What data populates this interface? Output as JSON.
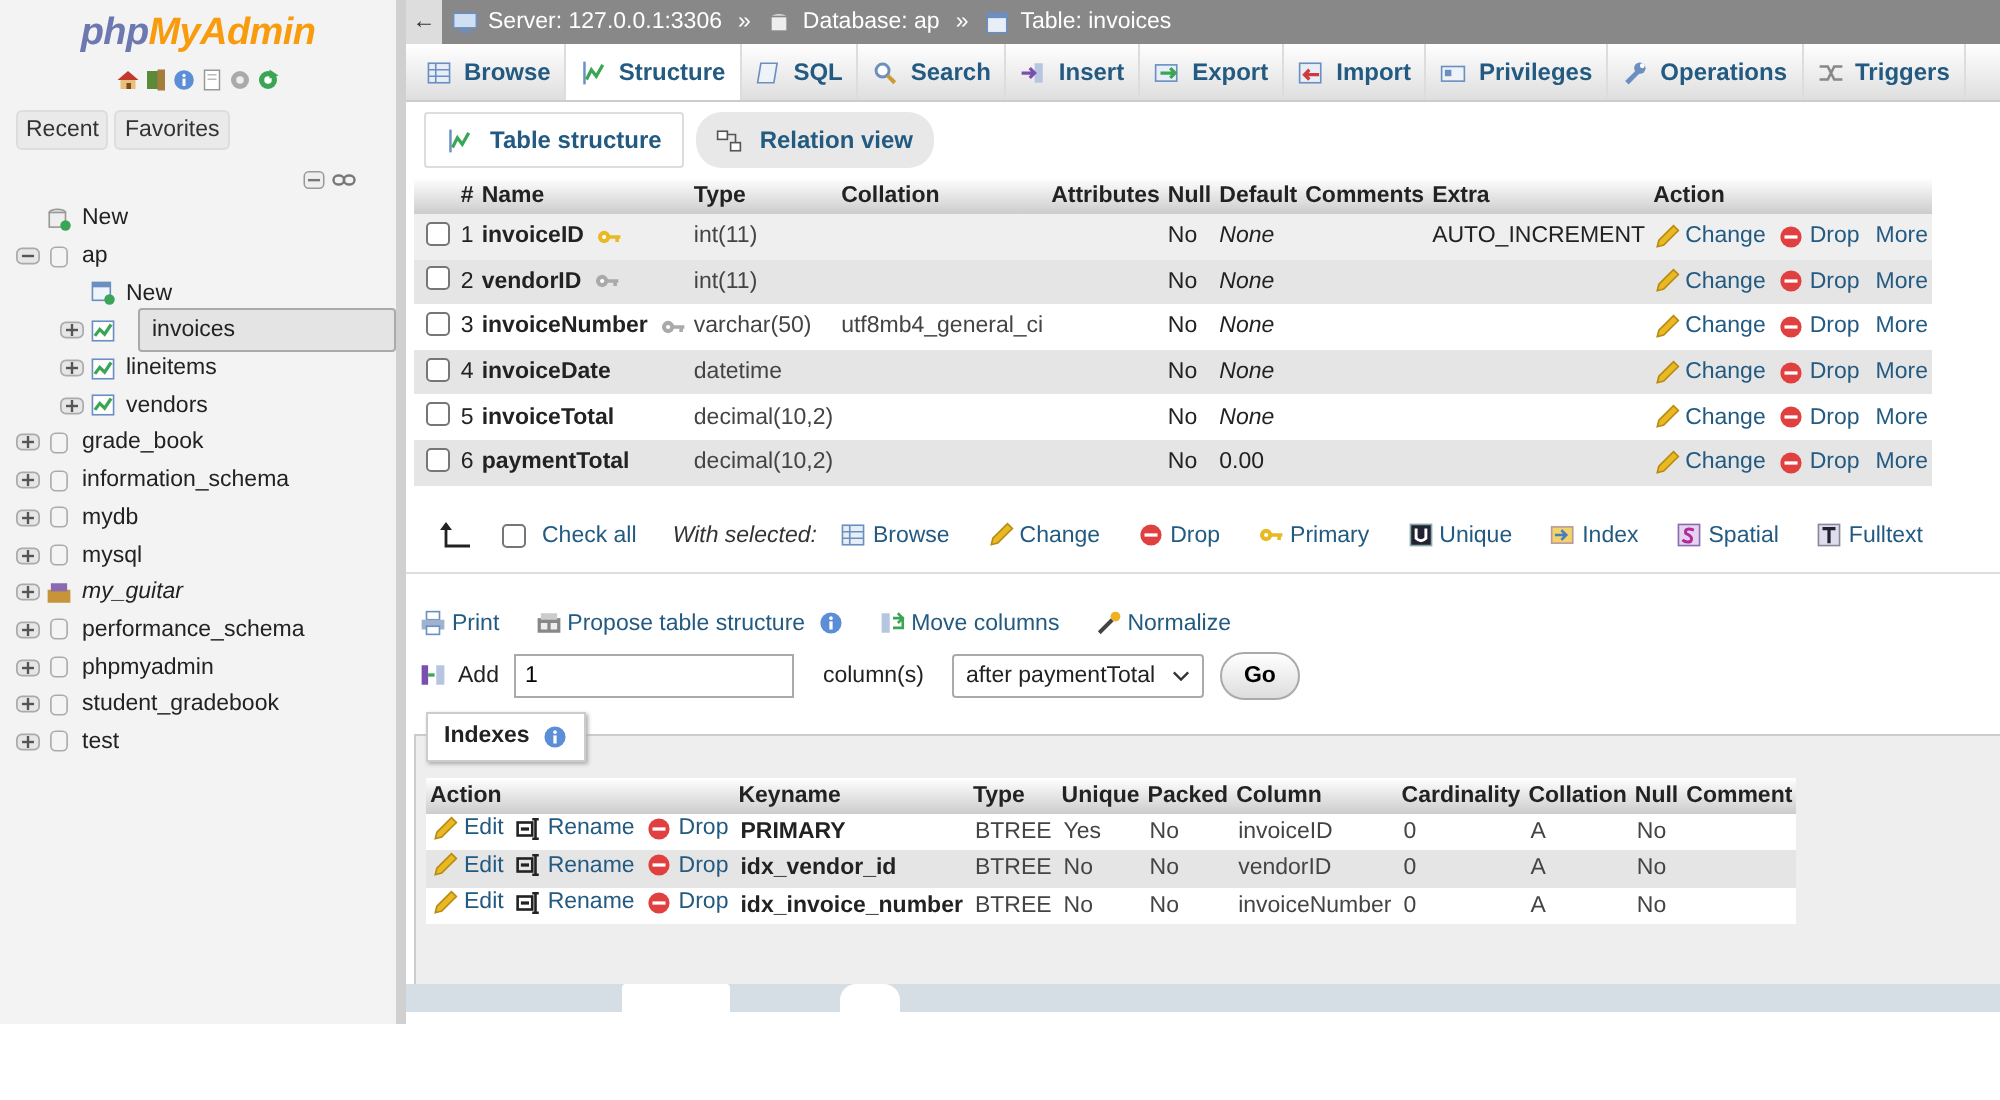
{
  "sidebar": {
    "logo": {
      "prefix": "php",
      "name": "MyAdmin"
    },
    "tabs": [
      {
        "label": "Recent"
      },
      {
        "label": "Favorites"
      }
    ],
    "tree": [
      {
        "kind": "new",
        "label": "New",
        "selected": false
      },
      {
        "kind": "db",
        "label": "ap",
        "expanded": true,
        "selected": false,
        "children": [
          {
            "kind": "new_table",
            "label": "New",
            "selected": false
          },
          {
            "kind": "table",
            "label": "invoices",
            "expanded": false,
            "selected": true
          },
          {
            "kind": "table",
            "label": "lineitems",
            "expanded": false,
            "selected": false
          },
          {
            "kind": "table",
            "label": "vendors",
            "expanded": false,
            "selected": false
          }
        ]
      },
      {
        "kind": "db",
        "label": "grade_book",
        "expanded": false,
        "selected": false
      },
      {
        "kind": "db",
        "label": "information_schema",
        "expanded": false,
        "selected": false
      },
      {
        "kind": "db",
        "label": "mydb",
        "expanded": false,
        "selected": false
      },
      {
        "kind": "db",
        "label": "mysql",
        "expanded": false,
        "selected": false
      },
      {
        "kind": "db_custom",
        "label": "my_guitar",
        "expanded": false,
        "selected": false
      },
      {
        "kind": "db",
        "label": "performance_schema",
        "expanded": false,
        "selected": false
      },
      {
        "kind": "db",
        "label": "phpmyadmin",
        "expanded": false,
        "selected": false
      },
      {
        "kind": "db",
        "label": "student_gradebook",
        "expanded": false,
        "selected": false
      },
      {
        "kind": "db",
        "label": "test",
        "expanded": false,
        "selected": false
      }
    ]
  },
  "breadcrumb": {
    "back": "←",
    "items": [
      {
        "kind": "server",
        "label": "Server: 127.0.0.1:3306"
      },
      {
        "kind": "sep",
        "label": "»"
      },
      {
        "kind": "database",
        "label": "Database: ap"
      },
      {
        "kind": "sep",
        "label": "»"
      },
      {
        "kind": "table",
        "label": "Table: invoices"
      }
    ]
  },
  "tabs": [
    {
      "kind": "browse",
      "label": "Browse",
      "selected": false
    },
    {
      "kind": "structure",
      "label": "Structure",
      "selected": true
    },
    {
      "kind": "sql",
      "label": "SQL",
      "selected": false
    },
    {
      "kind": "search",
      "label": "Search",
      "selected": false
    },
    {
      "kind": "insert",
      "label": "Insert",
      "selected": false
    },
    {
      "kind": "export",
      "label": "Export",
      "selected": false
    },
    {
      "kind": "import",
      "label": "Import",
      "selected": false
    },
    {
      "kind": "privileges",
      "label": "Privileges",
      "selected": false
    },
    {
      "kind": "operations",
      "label": "Operations",
      "selected": false
    },
    {
      "kind": "triggers",
      "label": "Triggers",
      "selected": false
    }
  ],
  "subtabs": [
    {
      "kind": "structure",
      "label": "Table structure",
      "selected": true
    },
    {
      "kind": "relation",
      "label": "Relation view",
      "selected": false
    }
  ],
  "structure": {
    "headers": [
      "#",
      "Name",
      "Type",
      "Collation",
      "Attributes",
      "Null",
      "Default",
      "Comments",
      "Extra",
      "Action"
    ],
    "rows": [
      {
        "num": "1",
        "name": "invoiceID",
        "kind": "primary",
        "type": "int(11)",
        "null": "No",
        "default": "None",
        "default_is_null": true,
        "extra": "AUTO_INCREMENT",
        "checked": false,
        "actions": [
          {
            "kind": "change",
            "label": "Change"
          },
          {
            "kind": "drop",
            "label": "Drop"
          },
          {
            "kind": "more",
            "label": "More"
          }
        ]
      },
      {
        "num": "2",
        "name": "vendorID",
        "kind": "index",
        "type": "int(11)",
        "null": "No",
        "default": "None",
        "default_is_null": true,
        "checked": false,
        "actions": [
          {
            "kind": "change",
            "label": "Change"
          },
          {
            "kind": "drop",
            "label": "Drop"
          },
          {
            "kind": "more",
            "label": "More"
          }
        ]
      },
      {
        "num": "3",
        "name": "invoiceNumber",
        "kind": "index",
        "type": "varchar(50)",
        "collation": "utf8mb4_general_ci",
        "null": "No",
        "default": "None",
        "default_is_null": true,
        "checked": false,
        "actions": [
          {
            "kind": "change",
            "label": "Change"
          },
          {
            "kind": "drop",
            "label": "Drop"
          },
          {
            "kind": "more",
            "label": "More"
          }
        ]
      },
      {
        "num": "4",
        "name": "invoiceDate",
        "kind": "plain",
        "type": "datetime",
        "null": "No",
        "default": "None",
        "default_is_null": true,
        "checked": false,
        "actions": [
          {
            "kind": "change",
            "label": "Change"
          },
          {
            "kind": "drop",
            "label": "Drop"
          },
          {
            "kind": "more",
            "label": "More"
          }
        ]
      },
      {
        "num": "5",
        "name": "invoiceTotal",
        "kind": "plain",
        "type": "decimal(10,2)",
        "null": "No",
        "default": "None",
        "default_is_null": true,
        "checked": false,
        "actions": [
          {
            "kind": "change",
            "label": "Change"
          },
          {
            "kind": "drop",
            "label": "Drop"
          },
          {
            "kind": "more",
            "label": "More"
          }
        ]
      },
      {
        "num": "6",
        "name": "paymentTotal",
        "kind": "plain",
        "type": "decimal(10,2)",
        "null": "No",
        "default": "0.00",
        "default_is_null": false,
        "checked": false,
        "actions": [
          {
            "kind": "change",
            "label": "Change"
          },
          {
            "kind": "drop",
            "label": "Drop"
          },
          {
            "kind": "more",
            "label": "More"
          }
        ]
      }
    ]
  },
  "bulk": {
    "check_all": "Check all",
    "checked": false,
    "with_selected": "With selected:",
    "actions": [
      {
        "kind": "browse",
        "label": "Browse"
      },
      {
        "kind": "change",
        "label": "Change"
      },
      {
        "kind": "drop",
        "label": "Drop"
      },
      {
        "kind": "primary",
        "label": "Primary"
      },
      {
        "kind": "unique",
        "label": "Unique"
      },
      {
        "kind": "index",
        "label": "Index"
      },
      {
        "kind": "spatial",
        "label": "Spatial"
      },
      {
        "kind": "fulltext",
        "label": "Fulltext"
      }
    ]
  },
  "tools": [
    {
      "kind": "print",
      "label": "Print"
    },
    {
      "kind": "propose",
      "label": "Propose table structure"
    },
    {
      "kind": "help"
    },
    {
      "kind": "move",
      "label": "Move columns"
    },
    {
      "kind": "normalize",
      "label": "Normalize"
    }
  ],
  "add_columns": {
    "label": "Add",
    "value": "1",
    "unit": "column(s)",
    "position": "after paymentTotal",
    "button": "Go"
  },
  "indexes": {
    "legend": "Indexes",
    "headers": [
      "Action",
      "Keyname",
      "Type",
      "Unique",
      "Packed",
      "Column",
      "Cardinality",
      "Collation",
      "Null",
      "Comment"
    ],
    "rows": [
      {
        "actions": [
          {
            "kind": "edit",
            "label": "Edit"
          },
          {
            "kind": "rename",
            "label": "Rename"
          },
          {
            "kind": "drop",
            "label": "Drop"
          }
        ],
        "keyname": "PRIMARY",
        "type": "BTREE",
        "unique": "Yes",
        "packed": "No",
        "column": "invoiceID",
        "cardinality": "0",
        "collation": "A",
        "null": "No"
      },
      {
        "actions": [
          {
            "kind": "edit",
            "label": "Edit"
          },
          {
            "kind": "rename",
            "label": "Rename"
          },
          {
            "kind": "drop",
            "label": "Drop"
          }
        ],
        "keyname": "idx_vendor_id",
        "type": "BTREE",
        "unique": "No",
        "packed": "No",
        "column": "vendorID",
        "cardinality": "0",
        "collation": "A",
        "null": "No"
      },
      {
        "actions": [
          {
            "kind": "edit",
            "label": "Edit"
          },
          {
            "kind": "rename",
            "label": "Rename"
          },
          {
            "kind": "drop",
            "label": "Drop"
          }
        ],
        "keyname": "idx_invoice_number",
        "type": "BTREE",
        "unique": "No",
        "packed": "No",
        "column": "invoiceNumber",
        "cardinality": "0",
        "collation": "A",
        "null": "No"
      }
    ]
  }
}
